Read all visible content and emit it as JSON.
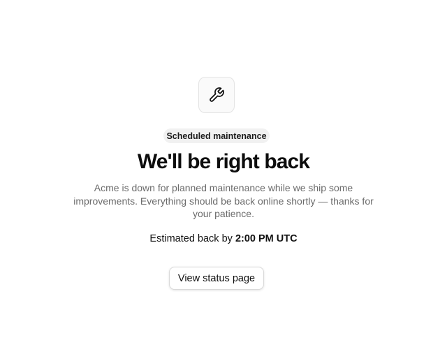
{
  "icon": {
    "name": "wrench-icon"
  },
  "badge": {
    "label": "Scheduled maintenance"
  },
  "title": "We'll be right back",
  "description": "Acme is down for planned maintenance while we ship some improvements. Everything should be back online shortly — thanks for your patience.",
  "estimate": {
    "prefix": "Estimated back by",
    "time": "2:00 PM UTC"
  },
  "actions": {
    "status_button_label": "View status page"
  }
}
